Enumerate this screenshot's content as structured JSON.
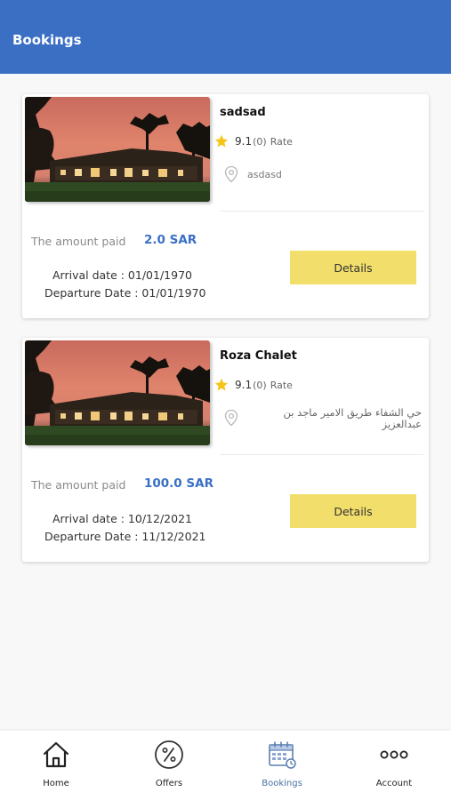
{
  "header": {
    "title": "Bookings"
  },
  "bookings": [
    {
      "name": "sadsad",
      "rating_score": "9.1",
      "rating_count": "(0)",
      "rating_label": "Rate",
      "address": "asdasd",
      "amount_label": "The amount paid",
      "amount_value": "2.0 SAR",
      "arrival": "Arrival date : 01/01/1970",
      "departure": "Departure Date : 01/01/1970",
      "details_label": "Details"
    },
    {
      "name": "Roza Chalet",
      "rating_score": "9.1",
      "rating_count": "(0)",
      "rating_label": "Rate",
      "address": "حي الشفاء طريق الامير ماجد بن عبدالعزيز",
      "amount_label": "The amount paid",
      "amount_value": "100.0 SAR",
      "arrival": "Arrival date : 10/12/2021",
      "departure": "Departure Date : 11/12/2021",
      "details_label": "Details"
    }
  ],
  "bottom_nav": {
    "items": [
      {
        "label": "Home",
        "icon": "home-icon"
      },
      {
        "label": "Offers",
        "icon": "percent-icon"
      },
      {
        "label": "Bookings",
        "icon": "calendar-icon",
        "active": true
      },
      {
        "label": "Account",
        "icon": "more-dots-icon"
      }
    ]
  },
  "colors": {
    "primary": "#3a6fc4",
    "button": "#f2de6b",
    "star": "#f5c518",
    "active_nav": "#4a6fa0"
  }
}
